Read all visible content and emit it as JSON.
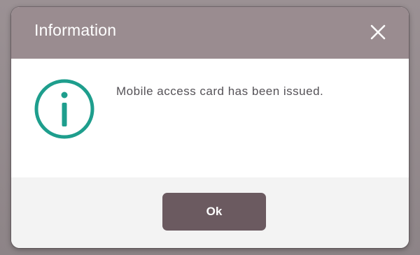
{
  "dialog": {
    "title": "Information",
    "close_icon": "close-icon",
    "info_icon": "info-icon",
    "message": "Mobile access card has been issued.",
    "ok_label": "Ok"
  },
  "colors": {
    "title_bar": "#9a8c90",
    "accent_teal": "#1e9e8d",
    "button": "#6b5a60",
    "backdrop": "#8a8184"
  }
}
